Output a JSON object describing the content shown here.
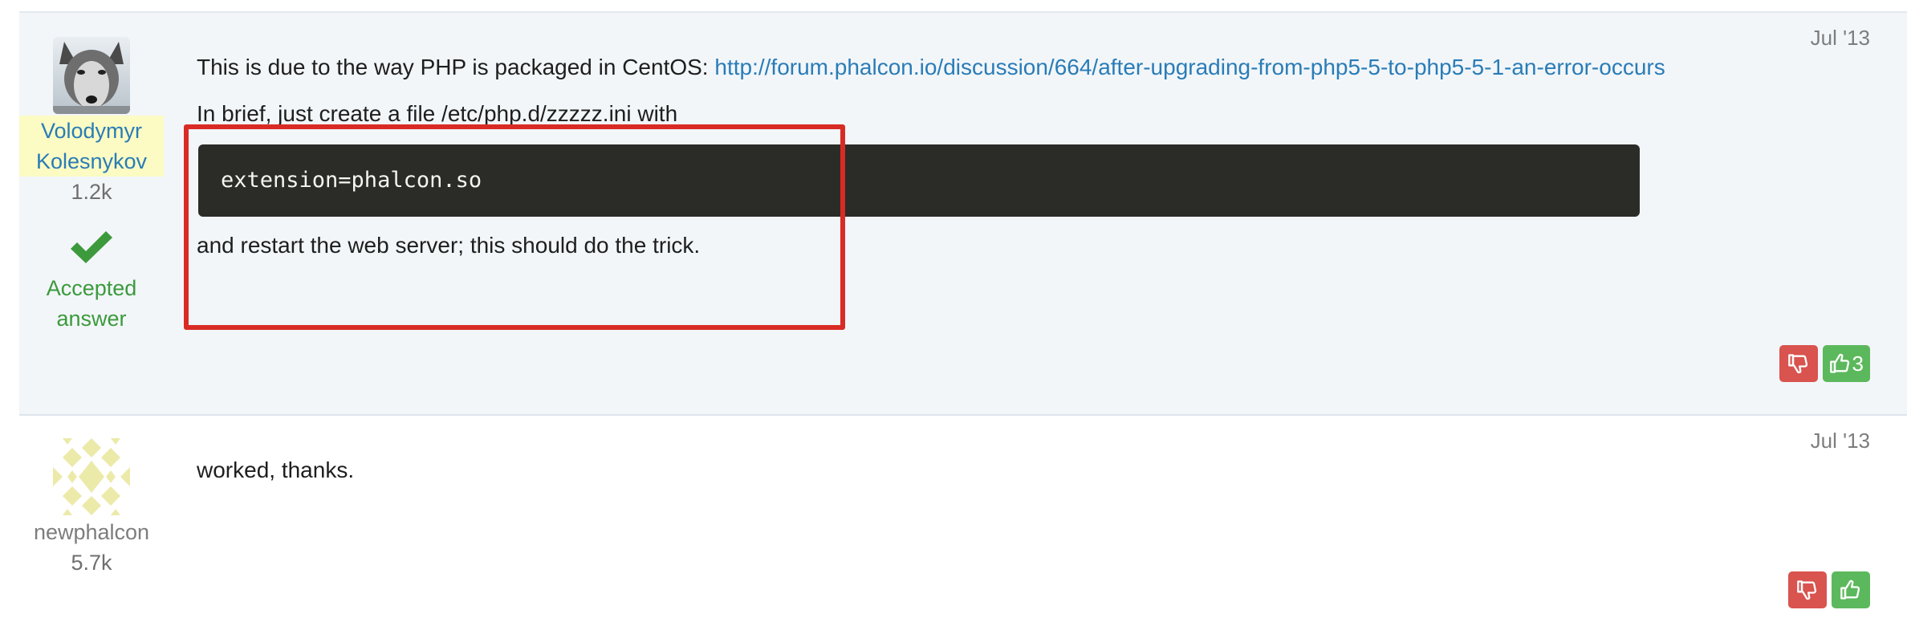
{
  "posts": [
    {
      "author": {
        "name": "Volodymyr Kolesnykov",
        "reputation": "1.2k",
        "highlighted": true
      },
      "date": "Jul '13",
      "accepted_label": "Accepted answer",
      "intro_text": "This is due to the way PHP is packaged in CentOS: ",
      "link_text": "http://forum.phalcon.io/discussion/664/after-upgrading-from-php5-5-to-php5-5-1-an-error-occurs",
      "brief_text": "In brief, just create a file /etc/php.d/zzzzz.ini with",
      "code": "extension=phalcon.so",
      "outro_text": "and restart the web server; this should do the trick.",
      "votes": {
        "up_count": "3"
      }
    },
    {
      "author": {
        "name": "newphalcon",
        "reputation": "5.7k"
      },
      "date": "Jul '13",
      "body": "worked, thanks.",
      "votes": {
        "up_count": ""
      }
    }
  ],
  "colors": {
    "accent_link": "#2a7cb7",
    "accepted_green": "#3c9a3c",
    "vote_down": "#d9534f",
    "vote_up": "#5cb85c",
    "highlight_box": "#d92b25",
    "code_bg": "#2b2b28"
  },
  "icons": {
    "accepted": "checkmark-icon",
    "vote_down": "thumbs-down-icon",
    "vote_up": "thumbs-up-icon",
    "avatar_1": "wolf-avatar",
    "avatar_2": "identicon-avatar"
  }
}
